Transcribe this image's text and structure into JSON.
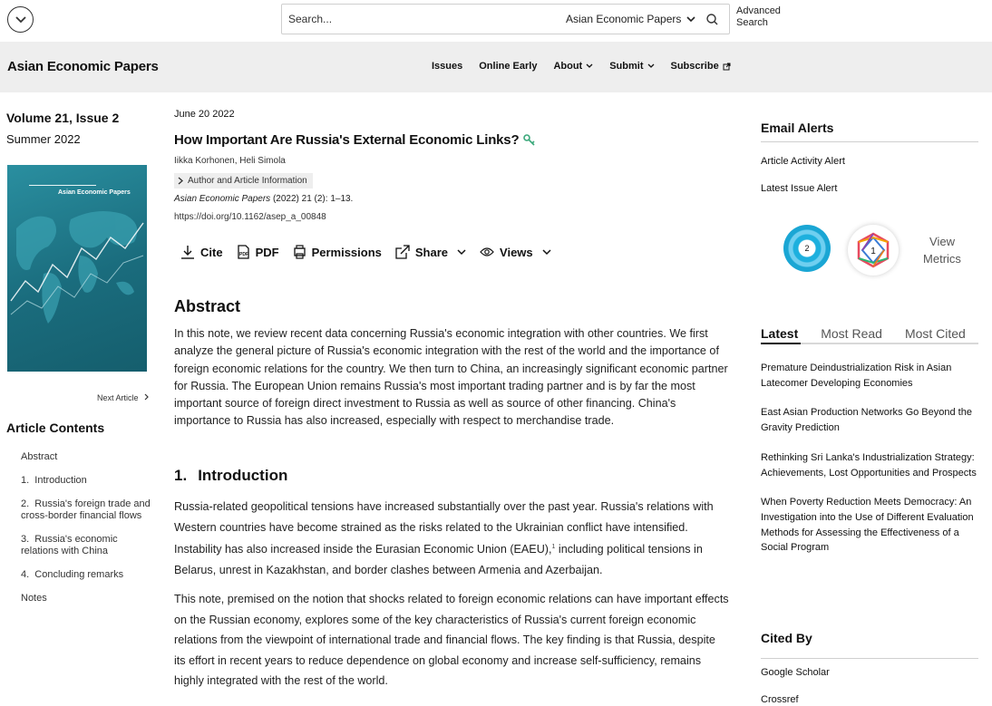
{
  "topbar": {
    "search_placeholder": "Search...",
    "search_scope": "Asian Economic Papers",
    "advanced_search": "Advanced Search"
  },
  "header": {
    "journal_title": "Asian Economic Papers",
    "nav": [
      {
        "label": "Issues"
      },
      {
        "label": "Online Early"
      },
      {
        "label": "About"
      },
      {
        "label": "Submit"
      },
      {
        "label": "Subscribe"
      }
    ]
  },
  "sidebar": {
    "volume": "Volume 21, Issue 2",
    "season": "Summer 2022",
    "cover_title": "Asian Economic Papers",
    "next_article": "Next Article",
    "contents_title": "Article Contents",
    "toc": [
      "Abstract",
      "1.  Introduction",
      "2.  Russia's foreign trade and cross-border financial flows",
      "3.  Russia's economic relations with China",
      "4.  Concluding remarks",
      "Notes"
    ]
  },
  "article": {
    "date": "June 20 2022",
    "title": "How Important Are Russia's External Economic Links?",
    "author1": "Iikka Korhonen",
    "author2": "Heli Simola",
    "author_info": "Author and Article Information",
    "citation_journal": "Asian Economic Papers",
    "citation_rest": " (2022) 21 (2): 1–13.",
    "doi": "https://doi.org/10.1162/asep_a_00848",
    "tools": {
      "cite": "Cite",
      "pdf": "PDF",
      "permissions": "Permissions",
      "share": "Share",
      "views": "Views"
    },
    "abstract_heading": "Abstract",
    "abstract": "In this note, we review recent data concerning Russia's economic integration with other countries. We first analyze the general picture of Russia's economic integration with the rest of the world and the importance of foreign economic relations for the country. We then turn to China, an increasingly significant economic partner for Russia. The European Union remains Russia's most important trading partner and is by far the most important source of foreign direct investment to Russia as well as source of other financing. China's importance to Russia has also increased, especially with respect to merchandise trade.",
    "intro_num": "1.",
    "intro_heading": "Introduction",
    "intro_p1_a": "Russia-related geopolitical tensions have increased substantially over the past year. Russia's relations with Western countries have become strained as the risks related to the Ukrainian conflict have intensified. Instability has also increased inside the Eurasian Economic Union (EAEU),",
    "intro_p1_sup": "1",
    "intro_p1_b": " including political tensions in Belarus, unrest in Kazakhstan, and border clashes between Armenia and Azerbaijan.",
    "intro_p2": "This note, premised on the notion that shocks related to foreign economic relations can have important effects on the Russian economy, explores some of the key characteristics of Russia's current foreign economic relations from the viewpoint of international trade and financial flows. The key finding is that Russia, despite its effort in recent years to reduce dependence on global economy and increase self-sufficiency, remains highly integrated with the rest of the world."
  },
  "right": {
    "email_alerts": "Email Alerts",
    "article_activity_alert": "Article Activity Alert",
    "latest_issue_alert": "Latest Issue Alert",
    "altmetric_score": "2",
    "dimensions_score": "1",
    "view_metrics": "View Metrics",
    "tabs": [
      "Latest",
      "Most Read",
      "Most Cited"
    ],
    "latest": [
      "Premature Deindustrialization Risk in Asian Latecomer Developing Economies",
      "East Asian Production Networks Go Beyond the Gravity Prediction",
      "Rethinking Sri Lanka's Industrialization Strategy: Achievements, Lost Opportunities and Prospects",
      "When Poverty Reduction Meets Democracy: An Investigation into the Use of Different Evaluation Methods for Assessing the Effectiveness of a Social Program"
    ],
    "cited_by": "Cited By",
    "google_scholar": "Google Scholar",
    "crossref": "Crossref"
  }
}
